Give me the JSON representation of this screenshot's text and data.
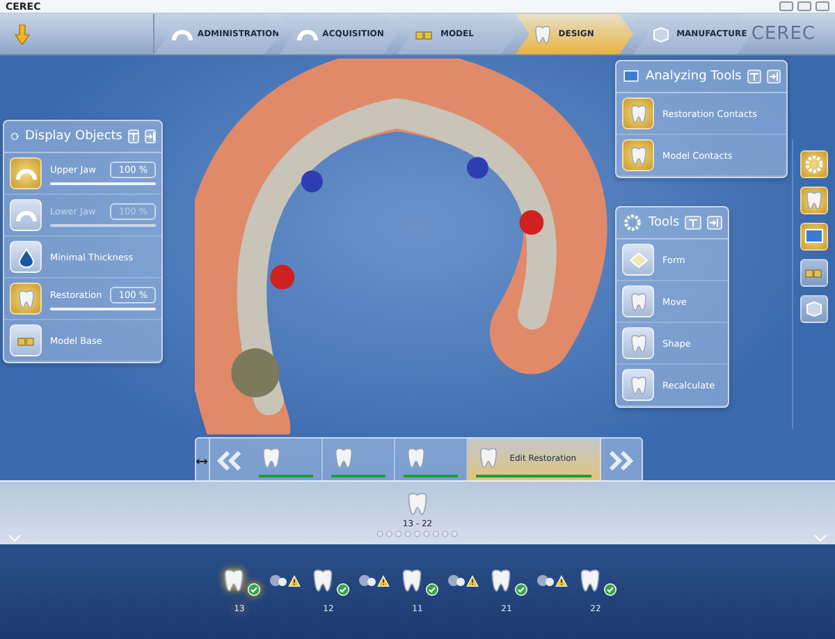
{
  "window": {
    "title": "CEREC"
  },
  "nav": {
    "steps": [
      {
        "label": "ADMINISTRATION",
        "selected": false
      },
      {
        "label": "ACQUISITION",
        "selected": false
      },
      {
        "label": "MODEL",
        "selected": false
      },
      {
        "label": "DESIGN",
        "selected": true
      },
      {
        "label": "MANUFACTURE",
        "selected": false
      }
    ],
    "logo": "CEREC"
  },
  "display_objects": {
    "title": "Display Objects",
    "items": [
      {
        "kind": "slider",
        "label": "Upper Jaw",
        "on": true,
        "disabled": false,
        "value": "100 %",
        "level": 1
      },
      {
        "kind": "slider",
        "label": "Lower Jaw",
        "on": false,
        "disabled": true,
        "value": "100 %",
        "level": 1
      },
      {
        "kind": "toggle",
        "label": "Minimal Thickness",
        "on": false
      },
      {
        "kind": "slider",
        "label": "Restoration",
        "on": true,
        "disabled": false,
        "value": "100 %",
        "level": 1
      },
      {
        "kind": "toggle",
        "label": "Model Base",
        "on": false
      }
    ]
  },
  "analyzing_tools": {
    "title": "Analyzing Tools",
    "items": [
      {
        "label": "Restoration Contacts",
        "on": true
      },
      {
        "label": "Model Contacts",
        "on": true
      }
    ]
  },
  "tools": {
    "title": "Tools",
    "items": [
      {
        "label": "Form"
      },
      {
        "label": "Move"
      },
      {
        "label": "Shape"
      },
      {
        "label": "Recalculate"
      }
    ]
  },
  "right_toolbar": [
    {
      "on": true
    },
    {
      "on": true
    },
    {
      "on": true
    },
    {
      "on": false
    },
    {
      "on": false
    }
  ],
  "workflow": {
    "steps": [
      {
        "selected": false,
        "level": 1
      },
      {
        "selected": false,
        "level": 1
      },
      {
        "selected": false,
        "level": 1
      },
      {
        "label": "Edit Restoration",
        "selected": true,
        "level": 1
      }
    ]
  },
  "restoration_group": {
    "label": "13 - 22"
  },
  "teeth": [
    {
      "kind": "tooth",
      "label": "13",
      "selected": true,
      "ok": true
    },
    {
      "kind": "connector",
      "ok": false
    },
    {
      "kind": "tooth",
      "label": "12",
      "selected": false,
      "ok": true
    },
    {
      "kind": "connector",
      "ok": false
    },
    {
      "kind": "tooth",
      "label": "11",
      "selected": false,
      "ok": true
    },
    {
      "kind": "connector",
      "ok": false
    },
    {
      "kind": "tooth",
      "label": "21",
      "selected": false,
      "ok": true
    },
    {
      "kind": "connector",
      "ok": false
    },
    {
      "kind": "tooth",
      "label": "22",
      "selected": false,
      "ok": true
    }
  ]
}
